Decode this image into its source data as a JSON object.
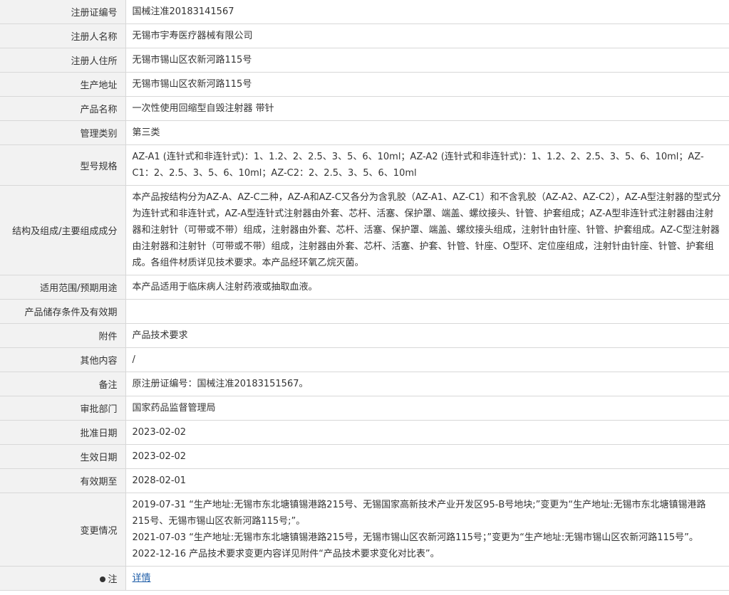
{
  "rows": [
    {
      "label": "注册证编号",
      "value": "国械注准20183141567"
    },
    {
      "label": "注册人名称",
      "value": "无锡市宇寿医疗器械有限公司"
    },
    {
      "label": "注册人住所",
      "value": "无锡市锡山区农新河路115号"
    },
    {
      "label": "生产地址",
      "value": "无锡市锡山区农新河路115号"
    },
    {
      "label": "产品名称",
      "value": "一次性使用回缩型自毁注射器 带针"
    },
    {
      "label": "管理类别",
      "value": "第三类"
    },
    {
      "label": "型号规格",
      "value": "AZ-A1 (连针式和非连针式)：1、1.2、2、2.5、3、5、6、10ml；AZ-A2 (连针式和非连针式)：1、1.2、2、2.5、3、5、6、10ml；AZ-C1：2、2.5、3、5、6、10ml；AZ-C2：2、2.5、3、5、6、10ml"
    },
    {
      "label": "结构及组成/主要组成成分",
      "value": "本产品按结构分为AZ-A、AZ-C二种，AZ-A和AZ-C又各分为含乳胶（AZ-A1、AZ-C1）和不含乳胶（AZ-A2、AZ-C2），AZ-A型注射器的型式分为连针式和非连针式，AZ-A型连针式注射器由外套、芯杆、活塞、保护罩、端盖、螺纹接头、针管、护套组成；AZ-A型非连针式注射器由注射器和注射针（可带或不带）组成，注射器由外套、芯杆、活塞、保护罩、端盖、螺纹接头组成，注射针由针座、针管、护套组成。AZ-C型注射器由注射器和注射针（可带或不带）组成，注射器由外套、芯杆、活塞、护套、针管、针座、O型环、定位座组成，注射针由针座、针管、护套组成。各组件材质详见技术要求。本产品经环氧乙烷灭菌。"
    },
    {
      "label": "适用范围/预期用途",
      "value": "本产品适用于临床病人注射药液或抽取血液。"
    },
    {
      "label": "产品储存条件及有效期",
      "value": ""
    },
    {
      "label": "附件",
      "value": "产品技术要求"
    },
    {
      "label": "其他内容",
      "value": "/"
    },
    {
      "label": "备注",
      "value": "原注册证编号：国械注准20183151567。"
    },
    {
      "label": "审批部门",
      "value": "国家药品监督管理局"
    },
    {
      "label": "批准日期",
      "value": "2023-02-02"
    },
    {
      "label": "生效日期",
      "value": "2023-02-02"
    },
    {
      "label": "有效期至",
      "value": "2028-02-01"
    }
  ],
  "changes": {
    "label": "变更情况",
    "entries": [
      "2019-07-31 “生产地址:无锡市东北塘镇锡港路215号、无锡国家高新技术产业开发区95-B号地块;”变更为“生产地址:无锡市东北塘镇锡港路215号、无锡市锡山区农新河路115号;”。",
      "2021-07-03 “生产地址:无锡市东北塘镇锡港路215号，无锡市锡山区农新河路115号；”变更为“生产地址:无锡市锡山区农新河路115号”。",
      "2022-12-16 产品技术要求变更内容详见附件“产品技术要求变化对比表”。"
    ]
  },
  "footer": {
    "label": "注",
    "link": "详情"
  }
}
